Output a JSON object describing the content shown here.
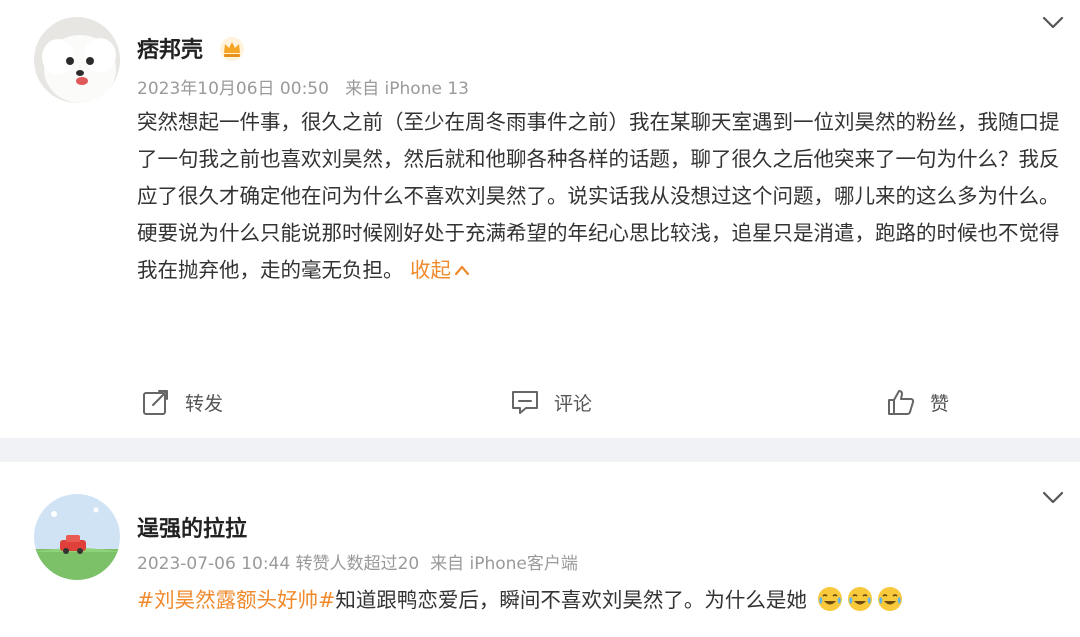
{
  "posts": [
    {
      "author": "痞邦壳",
      "timestamp": "2023年10月06日 00:50",
      "source": "来自 iPhone 13",
      "paragraphs": [
        "突然想起一件事，很久之前（至少在周冬雨事件之前）我在某聊天室遇到一位刘昊然的粉丝，我随口提了一句我之前也喜欢刘昊然，然后就和他聊各种各样的话题，聊了很久之后他突来了一句为什么？我反应了很久才确定他在问为什么不喜欢刘昊然了。说实话我从没想过这个问题，哪儿来的这么多为什么。",
        "硬要说为什么只能说那时候刚好处于充满希望的年纪心思比较浅，追星只是消遣，跑路的时候也不觉得我在抛弃他，走的毫无负担。"
      ],
      "collapse_label": "收起",
      "actions": {
        "repost": "转发",
        "comment": "评论",
        "like": "赞"
      }
    },
    {
      "author": "逞强的拉拉",
      "timestamp": "2023-07-06 10:44",
      "extra": "转赞人数超过20",
      "source": "来自 iPhone客户端",
      "hashtag": "#刘昊然露额头好帅#",
      "text": "知道跟鸭恋爱后，瞬间不喜欢刘昊然了。为什么是她",
      "emojis": [
        "crying-laughing-emoji",
        "crying-laughing-emoji",
        "crying-laughing-emoji"
      ]
    }
  ],
  "colors": {
    "accent": "#f08a2c",
    "meta": "#9a9a9a",
    "vip_badge": "#f5a623",
    "divider": "#f1f2f5"
  }
}
